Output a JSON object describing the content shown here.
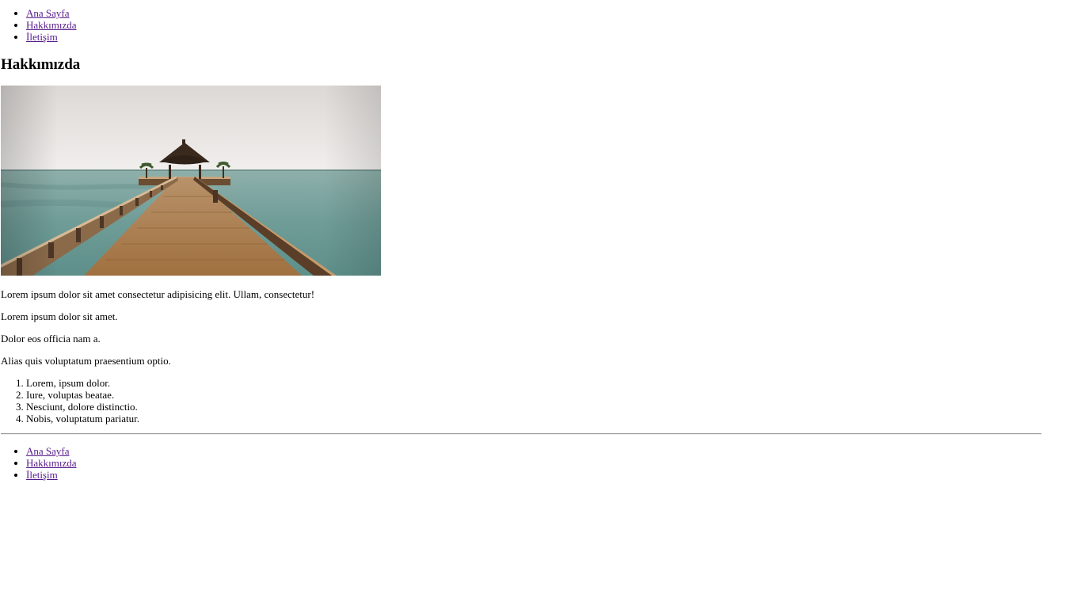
{
  "nav": {
    "items": [
      {
        "label": "Ana Sayfa"
      },
      {
        "label": "Hakkımızda"
      },
      {
        "label": "İletişim"
      }
    ]
  },
  "main": {
    "title": "Hakkımızda",
    "paragraphs": [
      "Lorem ipsum dolor sit amet consectetur adipisicing elit. Ullam, consectetur!",
      "Lorem ipsum dolor sit amet.",
      "Dolor eos officia nam a.",
      "Alias quis voluptatum praesentium optio."
    ],
    "list": [
      "Lorem, ipsum dolor.",
      "Iure, voluptas beatae.",
      "Nesciunt, dolore distinctio.",
      "Nobis, voluptatum pariatur."
    ]
  },
  "footer": {
    "nav": {
      "items": [
        {
          "label": "Ana Sayfa"
        },
        {
          "label": "Hakkımızda"
        },
        {
          "label": "İletişim"
        }
      ]
    }
  },
  "colors": {
    "link_visited": "#551a8b",
    "sky": "#ece9e6",
    "sea": "#6e9c96",
    "deck": "#a8784a"
  }
}
